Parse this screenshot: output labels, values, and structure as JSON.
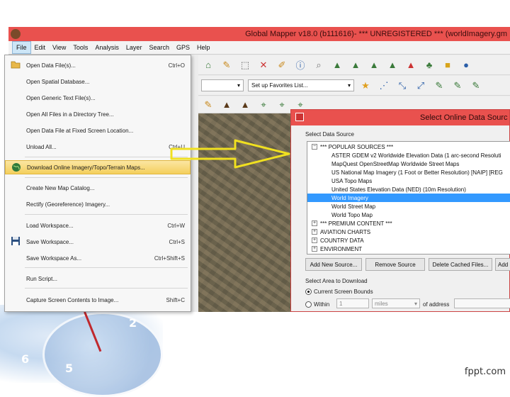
{
  "app": {
    "title": "Global Mapper v18.0 (b111616)- *** UNREGISTERED *** (worldImagery.gm"
  },
  "menubar": [
    "File",
    "Edit",
    "View",
    "Tools",
    "Analysis",
    "Layer",
    "Search",
    "GPS",
    "Help"
  ],
  "toolbar": {
    "favorites_placeholder": "Set up Favorites List..."
  },
  "file_menu": {
    "items": [
      {
        "label": "Open Data File(s)...",
        "shortcut": "Ctrl+O",
        "icon": "folder-icon"
      },
      {
        "label": "Open Spatial Database...",
        "shortcut": ""
      },
      {
        "label": "Open Generic Text File(s)...",
        "shortcut": ""
      },
      {
        "label": "Open All Files in a Directory Tree...",
        "shortcut": ""
      },
      {
        "label": "Open Data File at Fixed Screen Location...",
        "shortcut": ""
      },
      {
        "label": "Unload All...",
        "shortcut": "Ctrl+U"
      },
      {
        "label": "Download Online Imagery/Topo/Terrain Maps...",
        "shortcut": "",
        "icon": "globe-icon",
        "highlighted": true
      },
      {
        "label": "Create New Map Catalog...",
        "shortcut": ""
      },
      {
        "label": "Rectify (Georeference) Imagery...",
        "shortcut": ""
      },
      {
        "label": "Load Workspace...",
        "shortcut": "Ctrl+W"
      },
      {
        "label": "Save Workspace...",
        "shortcut": "Ctrl+S",
        "icon": "floppy-icon"
      },
      {
        "label": "Save Workspace As...",
        "shortcut": "Ctrl+Shift+S"
      },
      {
        "label": "Run Script...",
        "shortcut": ""
      },
      {
        "label": "Capture Screen Contents to Image...",
        "shortcut": "Shift+C"
      }
    ]
  },
  "dialog": {
    "title": "Select Online Data Sourc",
    "select_label": "Select Data Source",
    "tree": [
      {
        "label": "*** POPULAR SOURCES ***",
        "level": 0,
        "expander": "−"
      },
      {
        "label": "ASTER GDEM v2 Worldwide Elevation Data (1 arc-second Resoluti",
        "level": 1
      },
      {
        "label": "MapQuest OpenStreetMap Worldwide Street Maps",
        "level": 1
      },
      {
        "label": "US National Map Imagery (1 Foot or Better Resolution) [NAIP] [REG",
        "level": 1
      },
      {
        "label": "USA Topo Maps",
        "level": 1
      },
      {
        "label": "United States Elevation Data (NED) (10m Resolution)",
        "level": 1
      },
      {
        "label": "World Imagery",
        "level": 1,
        "selected": true
      },
      {
        "label": "World Street Map",
        "level": 1
      },
      {
        "label": "World Topo Map",
        "level": 1
      },
      {
        "label": "*** PREMIUM CONTENT ***",
        "level": 0,
        "expander": "+"
      },
      {
        "label": "AVIATION CHARTS",
        "level": 0,
        "expander": "+"
      },
      {
        "label": "COUNTRY DATA",
        "level": 0,
        "expander": "+"
      },
      {
        "label": "ENVIRONMENT",
        "level": 0,
        "expander": "+"
      }
    ],
    "buttons": {
      "add_new": "Add New Source...",
      "remove": "Remove Source",
      "delete_cached": "Delete Cached Files...",
      "more": "Add"
    },
    "area_label": "Select Area to Download",
    "radio_screen": "Current Screen Bounds",
    "radio_within": "Within",
    "within_value": "1",
    "units": "miles",
    "of_address": "of address"
  },
  "slide": {
    "clock_numbers": [
      "2",
      "6",
      "5"
    ],
    "brand": "fppt.com"
  }
}
